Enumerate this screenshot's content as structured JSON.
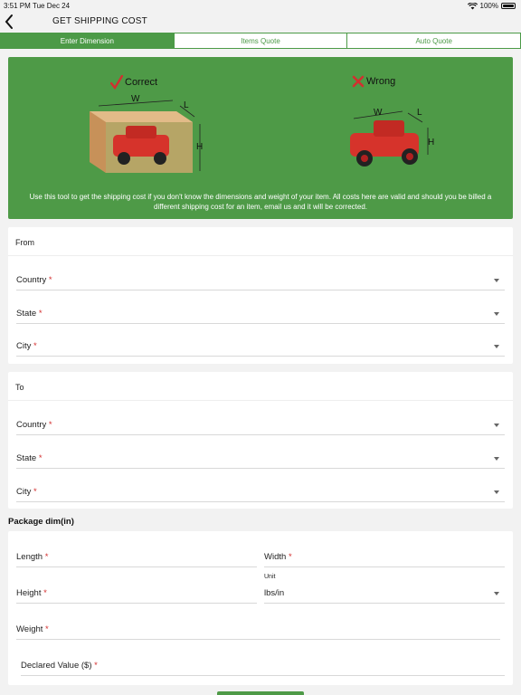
{
  "status": {
    "time": "3:51 PM",
    "date": "Tue Dec 24",
    "battery": "100%"
  },
  "header": {
    "title": "GET SHIPPING COST"
  },
  "tabs": [
    {
      "label": "Enter Dimension",
      "active": true
    },
    {
      "label": "Items Quote",
      "active": false
    },
    {
      "label": "Auto Quote",
      "active": false
    }
  ],
  "banner": {
    "correct_label": "Correct",
    "wrong_label": "Wrong",
    "dim_w": "W",
    "dim_l": "L",
    "dim_h": "H",
    "note": "Use this tool to get the shipping cost if you don't know the dimensions and weight of your item. All costs here are valid and should you be billed a different shipping cost for an item, email us and it will be corrected.",
    "colors": {
      "background": "#4e9a47",
      "check": "#d32f2f",
      "cross": "#d32f2f"
    }
  },
  "from": {
    "title": "From",
    "country": "Country",
    "state": "State",
    "city": "City",
    "required_mark": "*"
  },
  "to": {
    "title": "To",
    "country": "Country",
    "state": "State",
    "city": "City",
    "required_mark": "*"
  },
  "package": {
    "title": "Package dim(in)",
    "length": "Length",
    "width": "Width",
    "height": "Height",
    "unit_caption": "Unit",
    "unit_value": "lbs/in",
    "weight": "Weight",
    "declared": "Declared Value ($)",
    "required_mark": "*"
  }
}
